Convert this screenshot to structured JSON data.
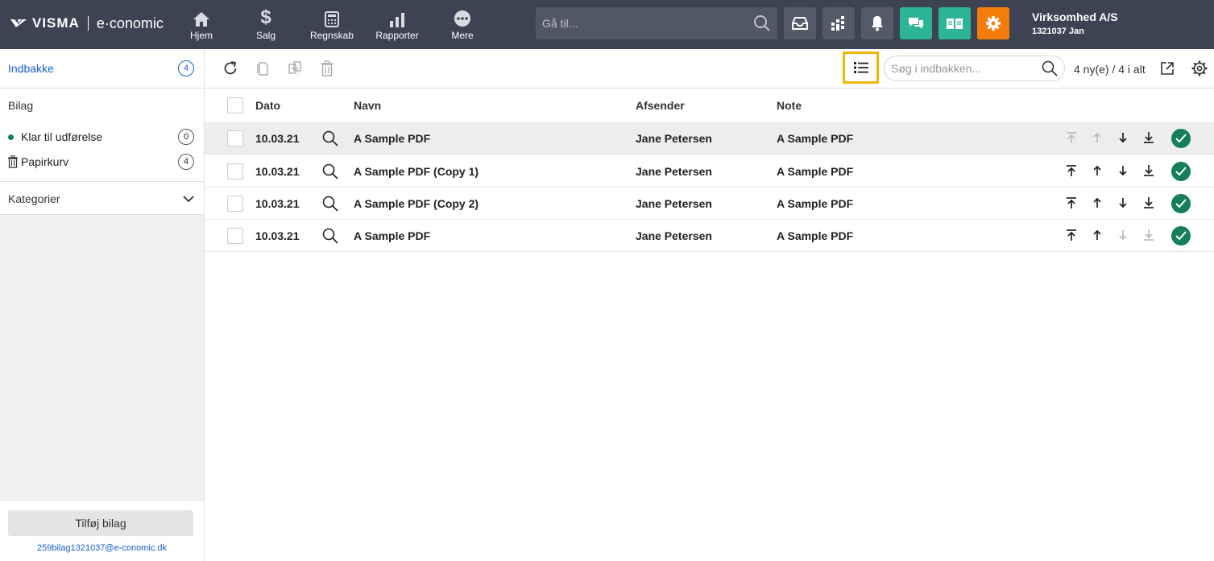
{
  "topbar": {
    "brand": "VISMA",
    "product": "e·conomic",
    "nav": [
      {
        "label": "Hjem",
        "icon": "home-icon"
      },
      {
        "label": "Salg",
        "icon": "dollar-icon"
      },
      {
        "label": "Regnskab",
        "icon": "calculator-icon"
      },
      {
        "label": "Rapporter",
        "icon": "bar-chart-icon"
      },
      {
        "label": "Mere",
        "icon": "more-icon"
      }
    ],
    "search_placeholder": "Gå til...",
    "company_name": "Virksomhed A/S",
    "company_user": "1321037 Jan",
    "colors": {
      "bar": "#3e4354",
      "chat": "#2bb596",
      "guide": "#2bb596",
      "settings": "#f47d0a"
    }
  },
  "sidebar": {
    "inbox_label": "Indbakke",
    "inbox_count": "4",
    "bilag_label": "Bilag",
    "ready_label": "Klar til udførelse",
    "ready_count": "0",
    "trash_label": "Papirkurv",
    "trash_count": "4",
    "categories_label": "Kategorier",
    "add_button": "Tilføj bilag",
    "email": "259bilag1321037@e-conomic.dk"
  },
  "toolbar": {
    "search_placeholder": "Søg i indbakken...",
    "counter": "4 ny(e) / 4 i alt"
  },
  "table": {
    "headers": {
      "date": "Dato",
      "name": "Navn",
      "sender": "Afsender",
      "note": "Note"
    },
    "rows": [
      {
        "date": "10.03.21",
        "name": "A Sample PDF",
        "sender": "Jane Petersen",
        "note": "A Sample PDF",
        "up_disabled": true,
        "down_disabled": false
      },
      {
        "date": "10.03.21",
        "name": "A Sample PDF (Copy 1)",
        "sender": "Jane Petersen",
        "note": "A Sample PDF",
        "up_disabled": false,
        "down_disabled": false
      },
      {
        "date": "10.03.21",
        "name": "A Sample PDF (Copy 2)",
        "sender": "Jane Petersen",
        "note": "A Sample PDF",
        "up_disabled": false,
        "down_disabled": false
      },
      {
        "date": "10.03.21",
        "name": "A Sample PDF",
        "sender": "Jane Petersen",
        "note": "A Sample PDF",
        "up_disabled": false,
        "down_disabled": true
      }
    ]
  }
}
